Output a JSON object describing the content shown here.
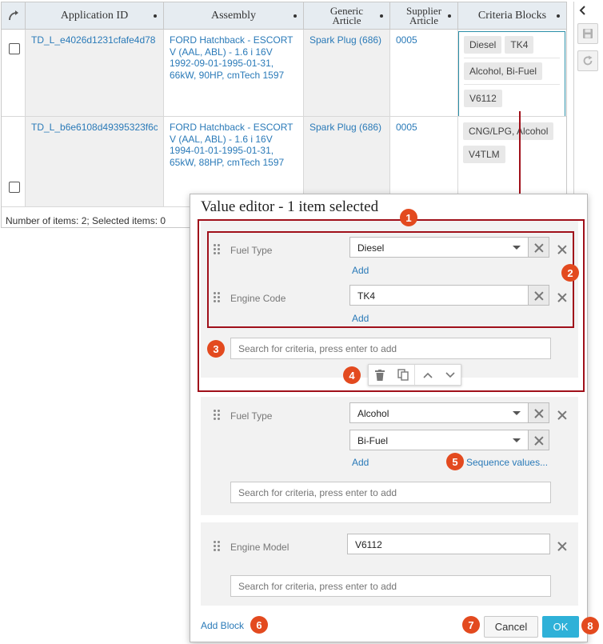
{
  "grid": {
    "columns": [
      "Application ID",
      "Assembly",
      "Generic Article",
      "Supplier Article",
      "Criteria Blocks"
    ],
    "column_lines": {
      "generic_1": "Generic",
      "generic_2": "Article",
      "supplier_1": "Supplier",
      "supplier_2": "Article"
    },
    "rows": [
      {
        "app_id": "TD_L_e4026d1231cfafe4d78",
        "assembly": "FORD Hatchback - ESCORT V (AAL, ABL) - 1.6 i 16V 1992-09-01-1995-01-31, 66kW, 90HP, cmTech 1597",
        "generic": "Spark Plug (686)",
        "supplier": "0005",
        "criteria": [
          [
            "Diesel",
            "TK4"
          ],
          [
            "Alcohol, Bi-Fuel"
          ],
          [
            "V6112"
          ]
        ]
      },
      {
        "app_id": "TD_L_b6e6108d49395323f6c",
        "assembly": "FORD Hatchback - ESCORT V (AAL, ABL) - 1.6 i 16V 1994-01-01-1995-01-31, 65kW, 88HP, cmTech 1597",
        "generic": "Spark Plug (686)",
        "supplier": "0005",
        "criteria": [
          [
            "CNG/LPG, Alcohol"
          ],
          [
            "V4TLM"
          ]
        ]
      }
    ],
    "footer": "Number of items: 2; Selected items: 0"
  },
  "dialog": {
    "title": "Value editor - 1 item selected",
    "blocks": [
      {
        "rows": [
          {
            "label": "Fuel Type",
            "values": [
              "Diesel"
            ],
            "add": "Add"
          },
          {
            "label": "Engine Code",
            "values": [
              "TK4"
            ],
            "add": "Add"
          }
        ],
        "search_placeholder": "Search for criteria, press enter to add"
      },
      {
        "rows": [
          {
            "label": "Fuel Type",
            "values": [
              "Alcohol",
              "Bi-Fuel"
            ],
            "add": "Add",
            "sequence": "Sequence values..."
          }
        ],
        "search_placeholder": "Search for criteria, press enter to add"
      },
      {
        "rows": [
          {
            "label": "Engine Model",
            "values": [
              "V6112"
            ]
          }
        ],
        "search_placeholder": "Search for criteria, press enter to add"
      }
    ],
    "add_block": "Add Block",
    "cancel": "Cancel",
    "ok": "OK"
  },
  "badges": [
    "1",
    "2",
    "3",
    "4",
    "5",
    "6",
    "7",
    "8"
  ],
  "colors": {
    "link": "#2a7ab8",
    "badge": "#e34a1f",
    "highlight_frame": "#a0101a",
    "ok_button": "#2fb1d8",
    "connector": "#a0101a",
    "header_bg": "#e6ecf1"
  },
  "icons": [
    "refresh-link-icon",
    "save-icon",
    "reset-icon",
    "collapse-chevron-icon",
    "drag-handle-icon",
    "clear-icon",
    "remove-icon",
    "delete-icon",
    "copy-icon",
    "move-up-icon",
    "move-down-icon"
  ]
}
